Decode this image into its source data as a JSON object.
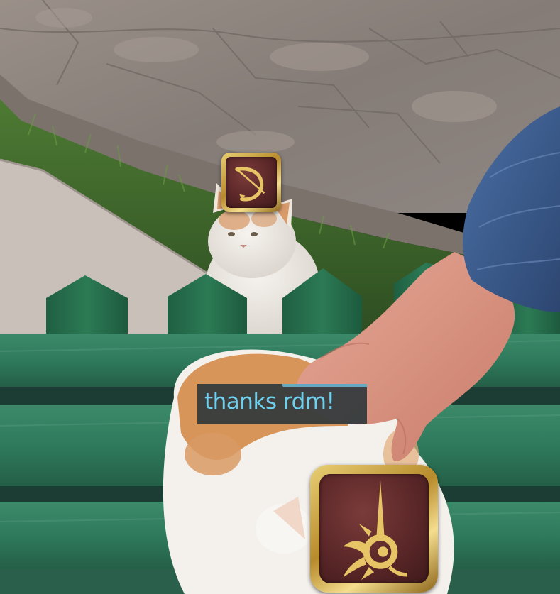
{
  "chat": {
    "message": "thanks rdm!"
  },
  "icons": {
    "top": {
      "name": "job-icon-top",
      "color_gold": "#d6b25a",
      "color_bg": "#5b2728"
    },
    "bottom": {
      "name": "red-mage-job-icon",
      "color_gold": "#d6b25a",
      "color_bg": "#5b2728"
    }
  },
  "colors": {
    "stone": "#8f8680",
    "grass": "#3f6a2c",
    "bench_green": "#2f7a5e",
    "fence_green": "#236b4c",
    "chat_text": "#6fd0ee",
    "chat_bg": "#283438"
  }
}
